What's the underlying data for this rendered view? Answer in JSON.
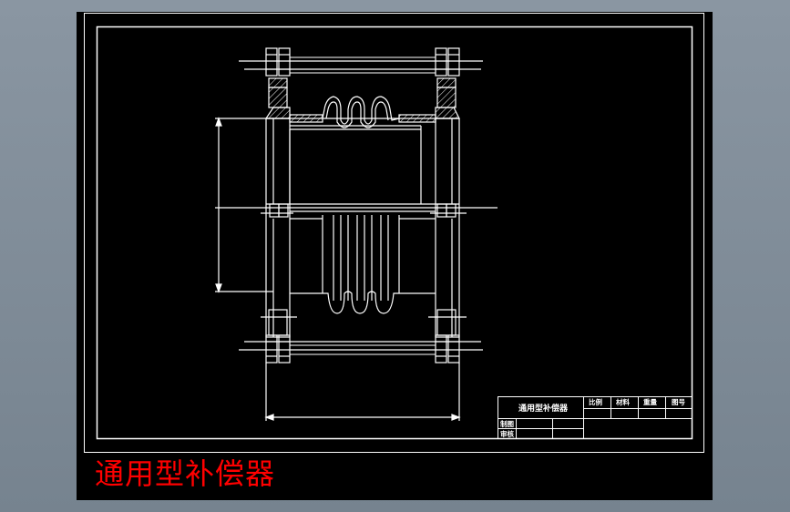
{
  "caption": "通用型补偿器",
  "title_block": {
    "drawing_name": "通用型补偿器",
    "col_scale": "比例",
    "col_material": "材料",
    "col_weight": "重量",
    "col_drawing_no": "图号",
    "row_drawn": "制图",
    "row_checked": "审核"
  },
  "colors": {
    "frame_bg": "#8a96a2",
    "sheet": "#000000",
    "lines": "#ffffff",
    "caption": "#ff0000"
  }
}
